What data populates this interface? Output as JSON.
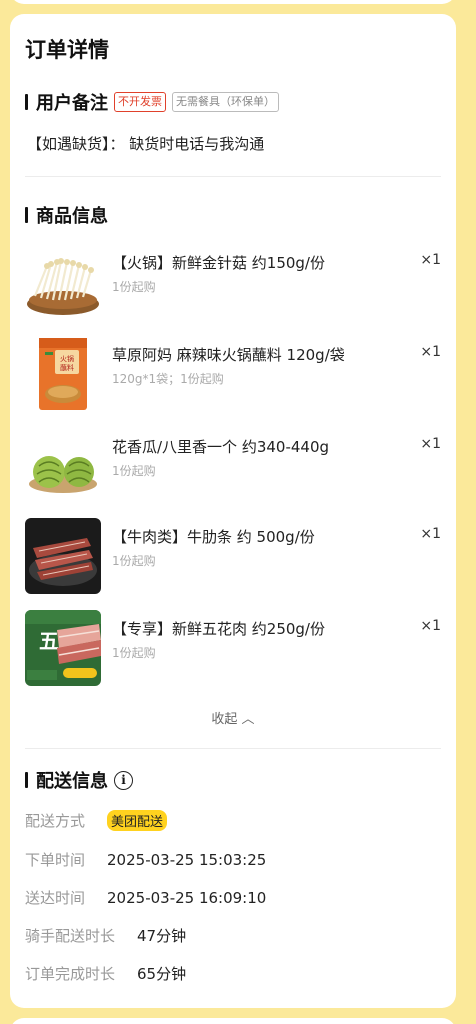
{
  "page": {
    "title": "订单详情"
  },
  "remarks": {
    "heading": "用户备注",
    "tag_invoice": "不开发票",
    "tag_utensils": "无需餐具（环保单）",
    "note": "【如遇缺货】：  缺货时电话与我沟通"
  },
  "products": {
    "heading": "商品信息",
    "items": [
      {
        "name": "【火锅】新鲜金针菇 约150g/份",
        "sub": "1份起购",
        "qty": "×1",
        "image": "enoki-mushroom"
      },
      {
        "name": "草原阿妈 麻辣味火锅蘸料 120g/袋",
        "sub": "120g*1袋；1份起购",
        "qty": "×1",
        "image": "hotpot-sauce-packet"
      },
      {
        "name": "花香瓜/八里香一个 约340-440g",
        "sub": "1份起购",
        "qty": "×1",
        "image": "melon"
      },
      {
        "name": "【牛肉类】牛肋条 约 500g/份",
        "sub": "1份起购",
        "qty": "×1",
        "image": "beef-rib-strips"
      },
      {
        "name": "【专享】新鲜五花肉 约250g/份",
        "sub": "1份起购",
        "qty": "×1",
        "image": "pork-belly"
      }
    ],
    "collapse_label": "收起 ︿"
  },
  "delivery": {
    "heading": "配送信息",
    "method_label": "配送方式",
    "method_value": "美团配送",
    "order_time_label": "下单时间",
    "order_time_value": "2025-03-25 15:03:25",
    "arrive_time_label": "送达时间",
    "arrive_time_value": "2025-03-25 16:09:10",
    "rider_duration_label": "骑手配送时长",
    "rider_duration_value": "47分钟",
    "complete_duration_label": "订单完成时长",
    "complete_duration_value": "65分钟"
  },
  "colors": {
    "background": "#fbe99a",
    "accent_yellow": "#ffd21f",
    "tag_red": "#e0412b"
  }
}
